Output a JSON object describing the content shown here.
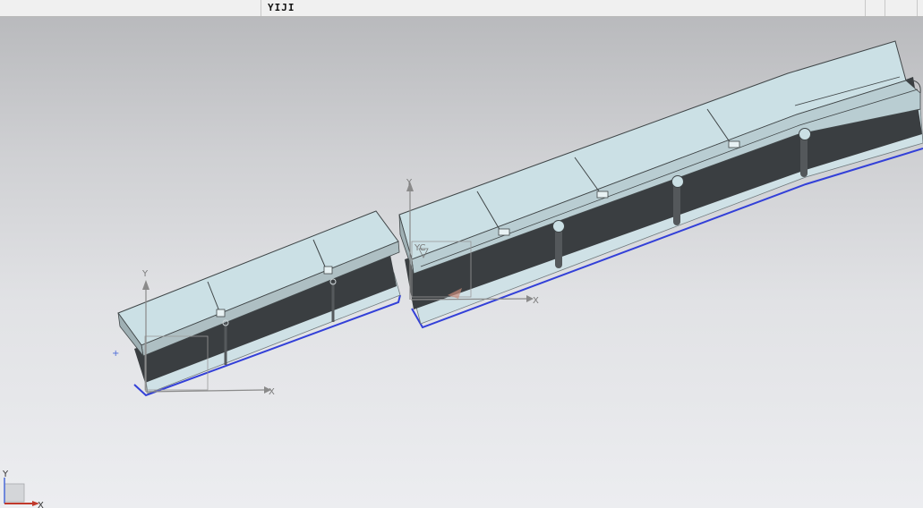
{
  "window": {
    "title": "YIJI"
  },
  "viewport": {
    "part_left": {
      "csys_x_label": "X",
      "csys_y_label": "Y"
    },
    "part_right": {
      "csys_x_label": "X",
      "csys_y_label": "Y",
      "wcs_label": "YC"
    },
    "triad": {
      "x_label": "X",
      "y_label": "Y"
    }
  },
  "colors": {
    "top_face": "#cbe0e5",
    "dark_wall": "#3a3e41",
    "edge_highlight": "#3340d8",
    "background_top": "#b9babd",
    "background_bottom": "#ecedf0"
  }
}
